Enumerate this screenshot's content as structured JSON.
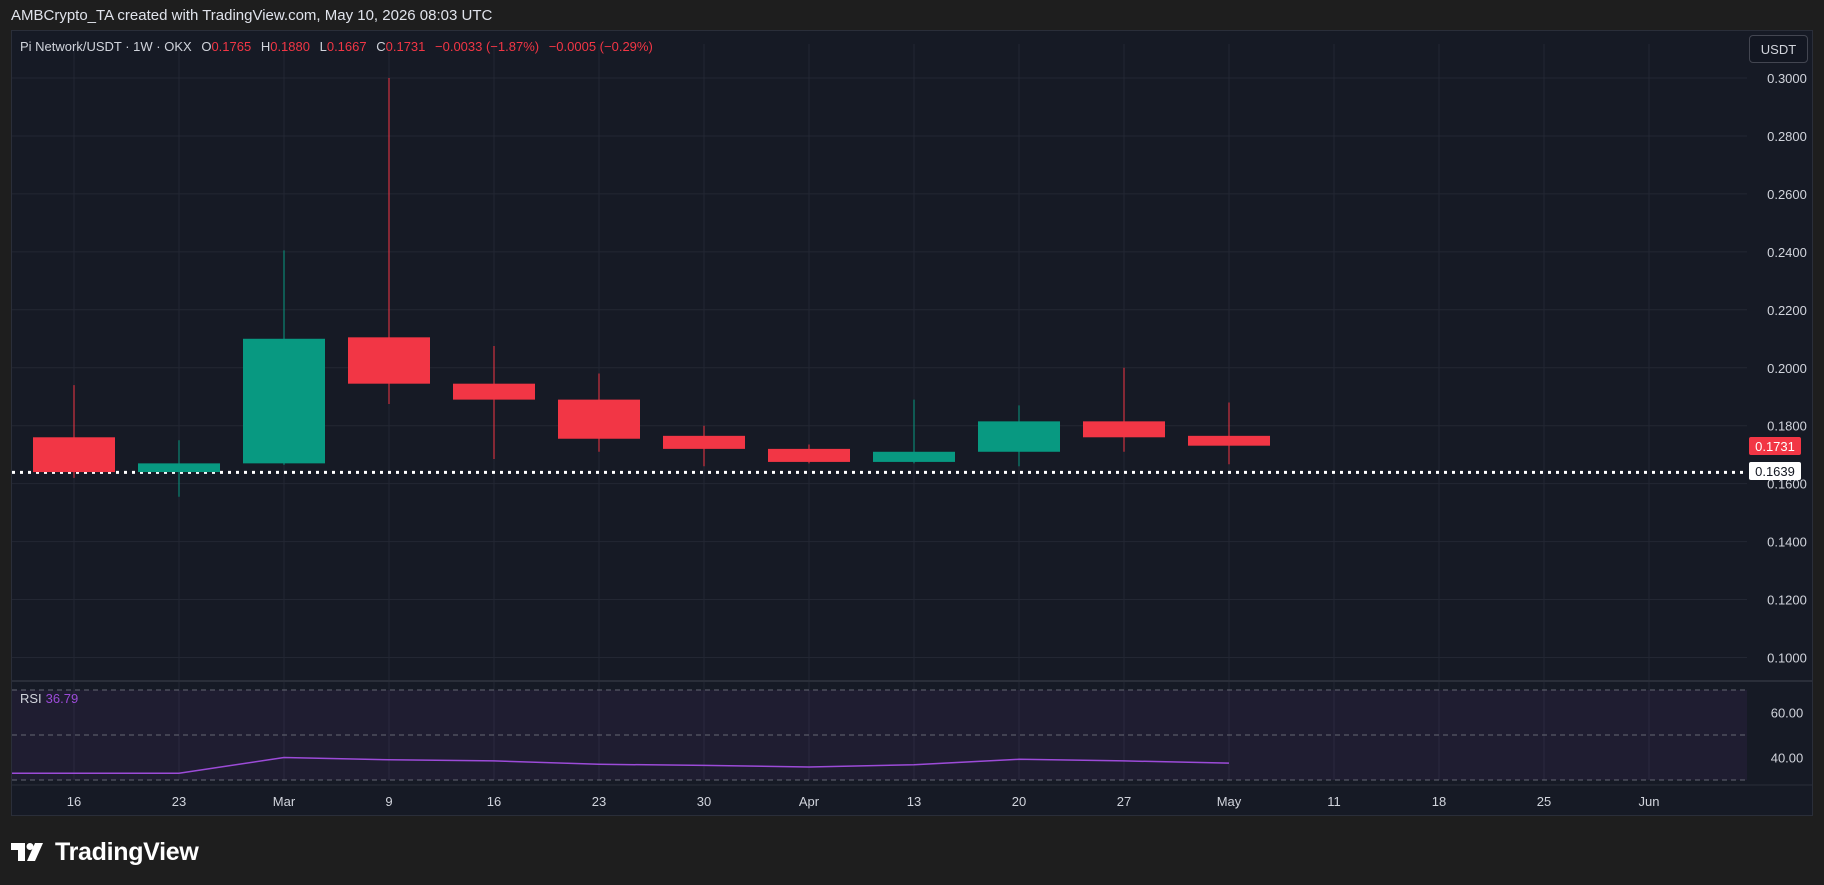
{
  "header": {
    "credit": "AMBCrypto_TA created with TradingView.com, May 10, 2026 08:03 UTC"
  },
  "symbol": {
    "name": "Pi Network/USDT · 1W · OKX",
    "o_label": "O",
    "o_value": "0.1765",
    "h_label": "H",
    "h_value": "0.1880",
    "l_label": "L",
    "l_value": "0.1667",
    "c_label": "C",
    "c_value": "0.1731",
    "change": "−0.0033 (−1.87%)",
    "change2": "−0.0005 (−0.29%)"
  },
  "currency_button": "USDT",
  "price_tags": {
    "last": "0.1731",
    "level": "0.1639"
  },
  "rsi": {
    "label": "RSI",
    "value": "36.79"
  },
  "branding": {
    "logo_text": "TradingView"
  },
  "colors": {
    "up": "#089981",
    "down": "#f23645",
    "rsi_line": "#9c4bd8",
    "grid": "#232733",
    "axis_text": "#d1d4dc"
  },
  "chart_data": [
    {
      "type": "candlestick",
      "interval": "1W",
      "x_tick_labels": [
        "16",
        "23",
        "Mar",
        "9",
        "16",
        "23",
        "30",
        "Apr",
        "13",
        "20",
        "27",
        "May",
        "11",
        "18",
        "25",
        "Jun"
      ],
      "y_tick_labels": [
        "0.1000",
        "0.1200",
        "0.1400",
        "0.1600",
        "0.1800",
        "0.2000",
        "0.2200",
        "0.2400",
        "0.2600",
        "0.2800",
        "0.3000"
      ],
      "ylim": [
        0.0945,
        0.3095
      ],
      "candles": [
        {
          "x": "16",
          "open": 0.176,
          "high": 0.194,
          "low": 0.162,
          "close": 0.164
        },
        {
          "x": "23",
          "open": 0.164,
          "high": 0.175,
          "low": 0.1555,
          "close": 0.167
        },
        {
          "x": "Mar",
          "open": 0.167,
          "high": 0.2405,
          "low": 0.1665,
          "close": 0.21
        },
        {
          "x": "9",
          "open": 0.2105,
          "high": 0.3,
          "low": 0.1875,
          "close": 0.1945
        },
        {
          "x": "16",
          "open": 0.1945,
          "high": 0.2075,
          "low": 0.1685,
          "close": 0.189
        },
        {
          "x": "23",
          "open": 0.189,
          "high": 0.198,
          "low": 0.171,
          "close": 0.1755
        },
        {
          "x": "30",
          "open": 0.1765,
          "high": 0.18,
          "low": 0.166,
          "close": 0.172
        },
        {
          "x": "Apr",
          "open": 0.172,
          "high": 0.1735,
          "low": 0.167,
          "close": 0.1675
        },
        {
          "x": "13",
          "open": 0.1675,
          "high": 0.189,
          "low": 0.167,
          "close": 0.171
        },
        {
          "x": "20",
          "open": 0.171,
          "high": 0.187,
          "low": 0.166,
          "close": 0.1815
        },
        {
          "x": "27",
          "open": 0.1815,
          "high": 0.2,
          "low": 0.171,
          "close": 0.176
        },
        {
          "x": "May",
          "open": 0.1765,
          "high": 0.188,
          "low": 0.1667,
          "close": 0.1731
        }
      ],
      "horizontal_levels": [
        0.1639
      ],
      "last_price": 0.1731
    },
    {
      "type": "line",
      "name": "RSI",
      "y_tick_labels": [
        "40.00",
        "60.00"
      ],
      "ylim": [
        30,
        70
      ],
      "x": [
        "16",
        "23",
        "Mar",
        "9",
        "16",
        "23",
        "30",
        "Apr",
        "13",
        "20",
        "27",
        "May"
      ],
      "values": [
        33.0,
        33.0,
        40.0,
        39.0,
        38.5,
        37.0,
        36.5,
        35.8,
        36.8,
        39.2,
        38.5,
        37.5
      ],
      "bands": [
        30,
        50,
        70
      ]
    }
  ]
}
